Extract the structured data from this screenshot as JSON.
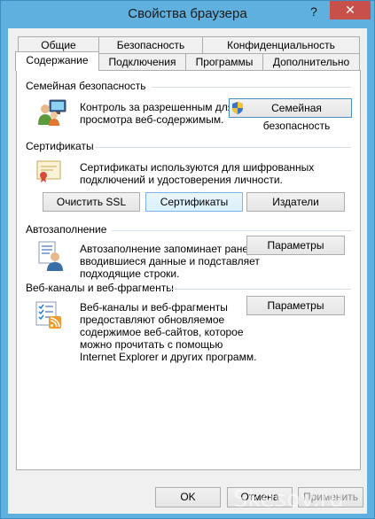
{
  "window": {
    "title": "Свойства браузера",
    "help_glyph": "?",
    "close_glyph": "✕"
  },
  "tabs_row1": [
    {
      "label": "Общие"
    },
    {
      "label": "Безопасность"
    },
    {
      "label": "Конфиденциальность"
    }
  ],
  "tabs_row2": [
    {
      "label": "Содержание",
      "active": true
    },
    {
      "label": "Подключения"
    },
    {
      "label": "Программы"
    },
    {
      "label": "Дополнительно"
    }
  ],
  "family": {
    "title": "Семейная безопасность",
    "text_line1": "Контроль за разрешенным для",
    "text_line2": "просмотра веб-содержимым.",
    "button": "Семейная безопасность"
  },
  "certificates": {
    "title": "Сертификаты",
    "text_line1": "Сертификаты используются для шифрованных",
    "text_line2": "подключений и удостоверения личности.",
    "buttons": {
      "clear_ssl": "Очистить SSL",
      "certificates": "Сертификаты",
      "publishers": "Издатели"
    }
  },
  "autocomplete": {
    "title": "Автозаполнение",
    "text_line1": "Автозаполнение запоминает ранее",
    "text_line2": "вводившиеся данные и подставляет",
    "text_line3": "подходящие строки.",
    "button": "Параметры"
  },
  "feeds": {
    "title": "Веб-каналы и веб-фрагменты",
    "text_line1": "Веб-каналы и веб-фрагменты",
    "text_line2": "предоставляют обновляемое",
    "text_line3": "содержимое веб-сайтов, которое",
    "text_line4": "можно прочитать с помощью",
    "text_line5": "Internet Explorer и других программ.",
    "button": "Параметры"
  },
  "footer": {
    "ok": "OK",
    "cancel": "Отмена",
    "apply": "Применить"
  },
  "watermark": "Skesov.ru"
}
